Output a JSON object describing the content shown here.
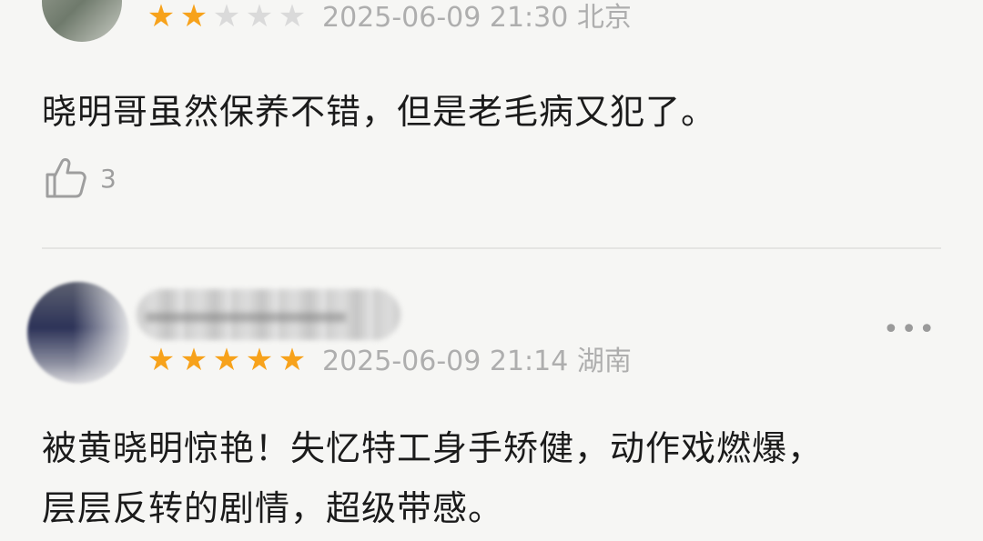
{
  "comments": [
    {
      "rating": 2,
      "max_rating": 5,
      "timestamp": "2025-06-09 21:30",
      "location": "北京",
      "text": "晓明哥虽然保养不错，但是老毛病又犯了。",
      "likes": "3"
    },
    {
      "rating": 5,
      "max_rating": 5,
      "timestamp": "2025-06-09 21:14",
      "location": "湖南",
      "text_line1": "被黄晓明惊艳！失忆特工身手矫健，动作戏燃爆，",
      "text_line2": "层层反转的剧情，超级带感。",
      "more": "•••"
    }
  ],
  "colors": {
    "star_on": "#f7a21b",
    "star_off": "#dadada",
    "meta_text": "#aeaeae",
    "body_text": "#1b1b1b",
    "background": "#f6f6f4"
  },
  "icons": {
    "star": "star-icon",
    "like": "thumbs-up-icon",
    "more": "more-icon"
  }
}
